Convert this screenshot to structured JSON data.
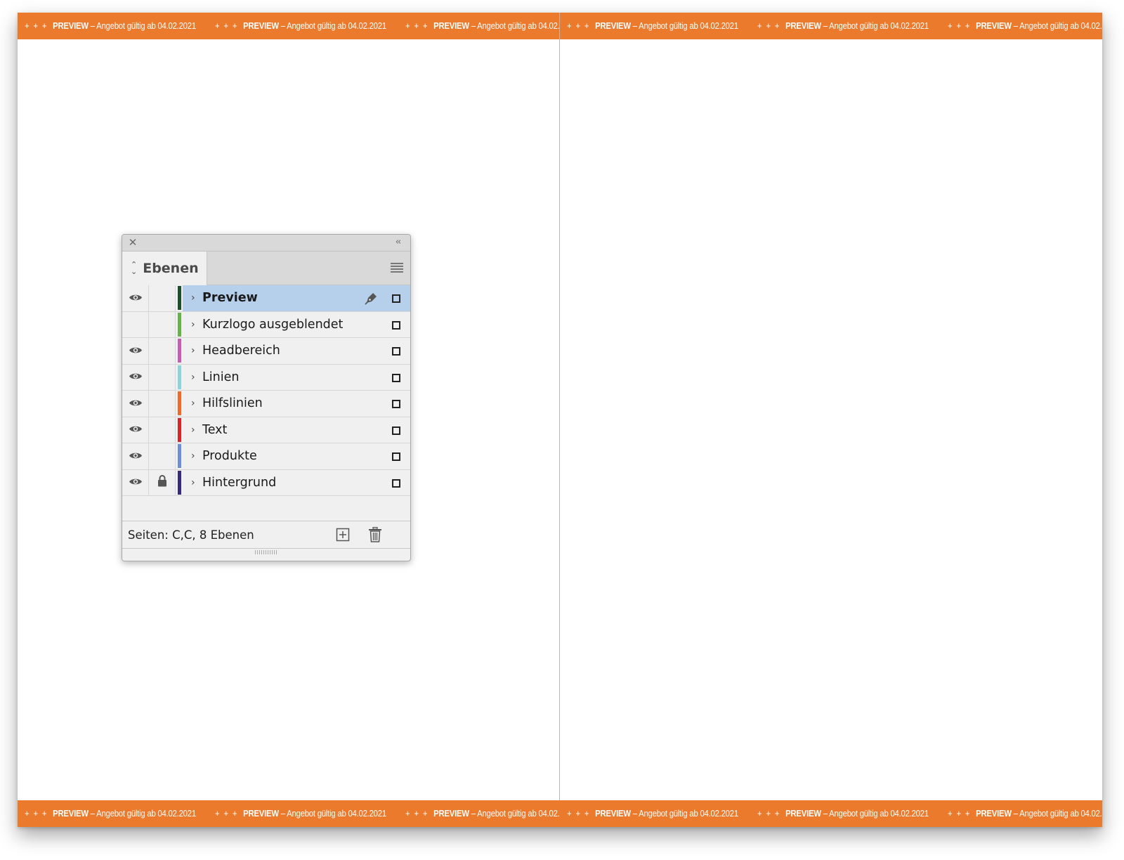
{
  "banner": {
    "plus": "+ + +",
    "bold": "PREVIEW",
    "text": " – Angebot gültig ab 04.02.2021"
  },
  "panel": {
    "tab_label": "Ebenen",
    "layers": [
      {
        "name": "Preview",
        "visible": true,
        "locked": false,
        "selected": true,
        "color": "#1f4d2b"
      },
      {
        "name": "Kurzlogo ausgeblendet",
        "visible": false,
        "locked": false,
        "selected": false,
        "color": "#6ab04c"
      },
      {
        "name": "Headbereich",
        "visible": true,
        "locked": false,
        "selected": false,
        "color": "#c25fb0"
      },
      {
        "name": "Linien",
        "visible": true,
        "locked": false,
        "selected": false,
        "color": "#8fd3d6"
      },
      {
        "name": "Hilfslinien",
        "visible": true,
        "locked": false,
        "selected": false,
        "color": "#ec6a2a"
      },
      {
        "name": "Text",
        "visible": true,
        "locked": false,
        "selected": false,
        "color": "#d8232a"
      },
      {
        "name": "Produkte",
        "visible": true,
        "locked": false,
        "selected": false,
        "color": "#6d8fcf"
      },
      {
        "name": "Hintergrund",
        "visible": true,
        "locked": true,
        "selected": false,
        "color": "#3a2a7a"
      }
    ],
    "footer_text": "Seiten: C,C, 8 Ebenen"
  },
  "colors": {
    "banner_orange": "#ec7a2c",
    "selection_blue": "#b6d0ec"
  }
}
